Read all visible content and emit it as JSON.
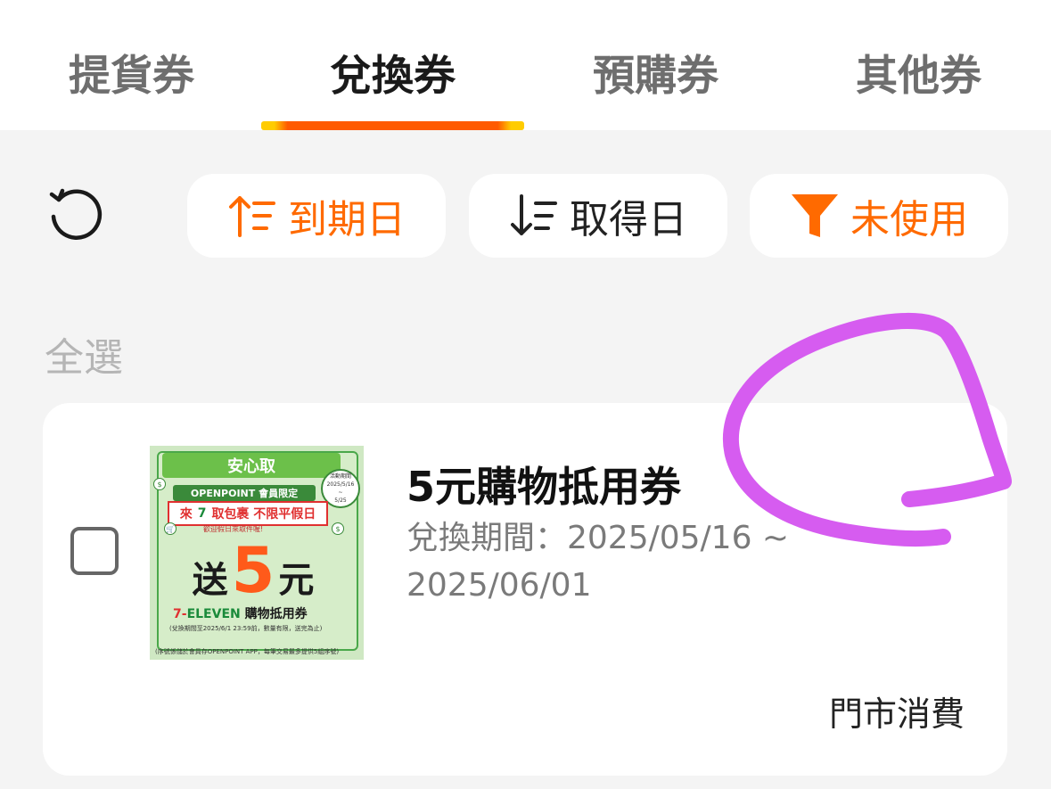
{
  "tabs": [
    {
      "label": "提貨券",
      "active": false
    },
    {
      "label": "兌換券",
      "active": true
    },
    {
      "label": "預購券",
      "active": false
    },
    {
      "label": "其他券",
      "active": false
    }
  ],
  "filters": {
    "refresh_icon": "refresh-icon",
    "expiry_sort": {
      "label": "到期日",
      "icon": "sort-ascending-icon",
      "color": "#ff6a00"
    },
    "acquired_sort": {
      "label": "取得日",
      "icon": "sort-descending-icon",
      "color": "#222222"
    },
    "status_filter": {
      "label": "未使用",
      "icon": "filter-funnel-icon",
      "color": "#ff6a00"
    }
  },
  "select_all": "全選",
  "coupon": {
    "title": "5元購物抵用券",
    "period_label": "兌換期間：2025/05/16 ~",
    "period_end": "2025/06/01",
    "usage": "門市消費",
    "image": {
      "banner": "安心取",
      "member": "OPENPOINT 會員限定",
      "promo_left": "來",
      "promo_right": "取包裹 不限平假日",
      "promo_sub": "歡迎假日來取件喔!",
      "period_badge": [
        "活動期間",
        "2025/5/16",
        "~",
        "5/25"
      ],
      "send": "送",
      "amount": "5",
      "unit": "元",
      "brand_seven": "7-",
      "brand_eleven": "ELEVEN",
      "brand_tail": "購物抵用券",
      "fine_print": "(兌換期間至2025/6/1 23:59前，數量有限，送完為止)",
      "footer": "(序號係儲於會員存OPENPOINT APP，每筆交易最多提供5組序號)"
    }
  },
  "colors": {
    "accent": "#ff6a00",
    "indicator_yellow": "#ffcc00",
    "annotation": "#d65cf0"
  }
}
